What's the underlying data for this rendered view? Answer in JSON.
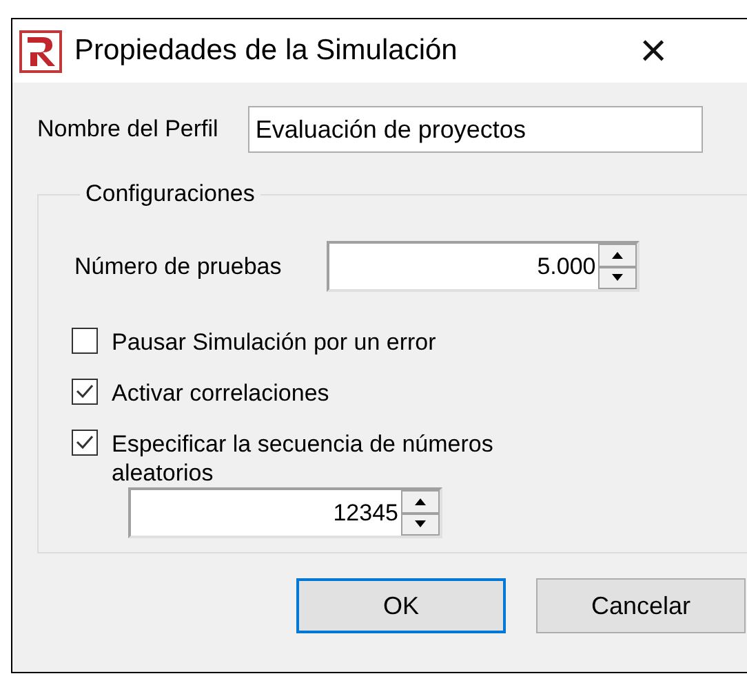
{
  "window": {
    "title": "Propiedades de la Simulación",
    "close": "×"
  },
  "profile": {
    "label": "Nombre del Perfil",
    "value": "Evaluación de proyectos"
  },
  "group": {
    "title": "Configuraciones",
    "trials": {
      "label": "Número de pruebas",
      "value": "5.000"
    },
    "options": [
      {
        "label": "Pausar Simulación por un error",
        "checked": false
      },
      {
        "label": "Activar correlaciones",
        "checked": true
      },
      {
        "label": "Especificar la secuencia de números aleatorios",
        "checked": true
      }
    ],
    "seed": {
      "value": "12345"
    }
  },
  "buttons": [
    {
      "label": "OK",
      "default": true
    },
    {
      "label": "Cancelar",
      "default": false
    }
  ]
}
